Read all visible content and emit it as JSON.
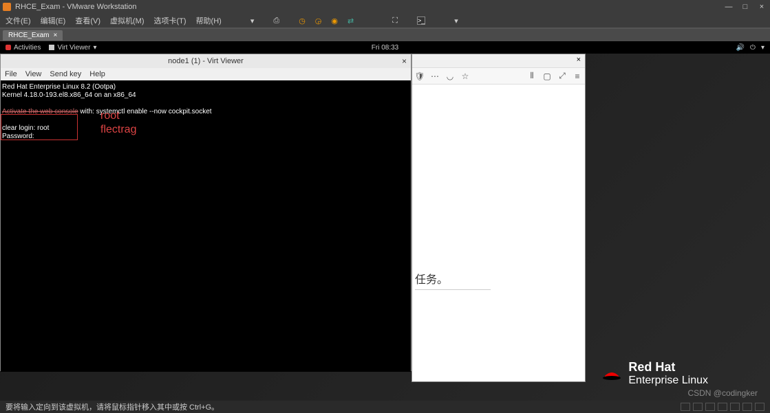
{
  "titlebar": {
    "title": "RHCE_Exam - VMware Workstation",
    "minimize": "—",
    "maximize": "□",
    "close": "×"
  },
  "menubar": {
    "file": "文件(E)",
    "edit": "编辑(E)",
    "view": "查看(V)",
    "vm": "虚拟机(M)",
    "tabs": "选项卡(T)",
    "help": "帮助(H)"
  },
  "tabs": {
    "tab1": "RHCE_Exam",
    "close": "×"
  },
  "gnome": {
    "activities": "Activities",
    "app": "Virt Viewer",
    "dropdown": "▾",
    "time": "Fri 08:33"
  },
  "virtviewer": {
    "title": "node1 (1) - Virt Viewer",
    "close": "×",
    "menu": {
      "file": "File",
      "view": "View",
      "sendkey": "Send key",
      "help": "Help"
    },
    "terminal": {
      "l1": "Red Hat Enterprise Linux 8.2 (Ootpa)",
      "l2": "Kernel 4.18.0-193.el8.x86_64 on an x86_64",
      "l3a": "Activate the web console",
      "l3b": " with: systemctl enable --now cockpit.socket",
      "l4": "clear login: root",
      "l5": "Password:"
    },
    "annotation": {
      "root": "root",
      "pass": "flectrag"
    }
  },
  "firefox": {
    "close": "×",
    "task_text": "任务。",
    "icons": {
      "shield": "🛡",
      "dots": "⋯",
      "pocket": "◡",
      "star": "☆",
      "lib": "⫴",
      "box": "▢",
      "stretch": "⤢",
      "menu": "≡"
    }
  },
  "redhat": {
    "line1": "Red Hat",
    "line2": "Enterprise Linux"
  },
  "watermark": "CSDN @codingker",
  "statusbar": {
    "msg": "要将输入定向到该虚拟机，请将鼠标指针移入其中或按 Ctrl+G。"
  }
}
